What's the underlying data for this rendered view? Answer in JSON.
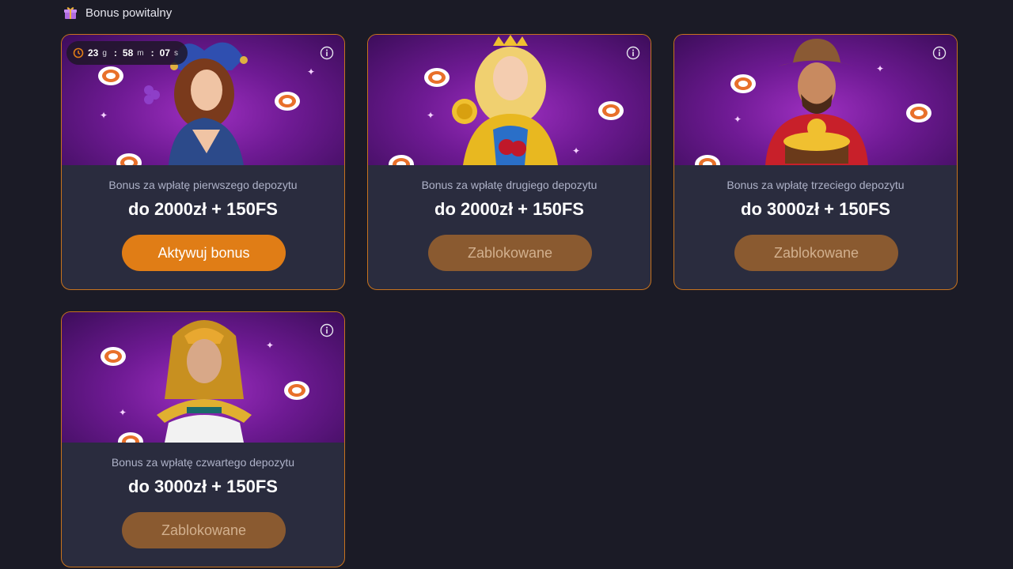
{
  "section": {
    "title": "Bonus powitalny",
    "icon": "gift-icon"
  },
  "cards": [
    {
      "subtitle": "Bonus za wpłatę pierwszego depozytu",
      "amount": "do 2000zł + 150FS",
      "button_label": "Aktywuj bonus",
      "button_state": "active",
      "character": "jester-woman",
      "timer": {
        "days": "23",
        "days_unit": "g",
        "minutes_hours": "58",
        "mh_unit": "m",
        "seconds": "07",
        "seconds_unit": "s"
      }
    },
    {
      "subtitle": "Bonus za wpłatę drugiego depozytu",
      "amount": "do 2000zł + 150FS",
      "button_label": "Zablokowane",
      "button_state": "locked",
      "character": "queen"
    },
    {
      "subtitle": "Bonus za wpłatę trzeciego depozytu",
      "amount": "do 3000zł + 150FS",
      "button_label": "Zablokowane",
      "button_state": "locked",
      "character": "treasure-hunter"
    },
    {
      "subtitle": "Bonus za wpłatę czwartego depozytu",
      "amount": "do 3000zł + 150FS",
      "button_label": "Zablokowane",
      "button_state": "locked",
      "character": "cleopatra"
    }
  ],
  "colors": {
    "background": "#1b1b26",
    "card": "#2a2c3e",
    "card_border": "#c8731d",
    "button_active": "#e07d16",
    "button_locked": "#8a5a30"
  }
}
